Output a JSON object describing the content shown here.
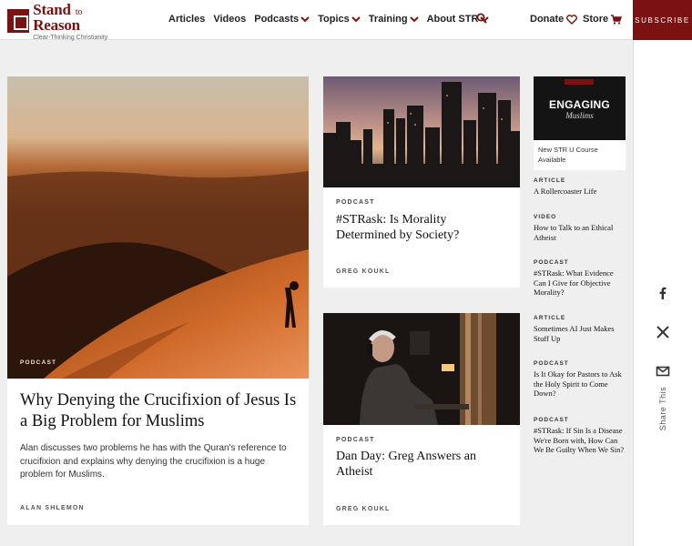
{
  "header": {
    "logo_name_1": "Stand",
    "logo_name_to": "to",
    "logo_name_2": "Reason",
    "logo_tag": "Clear-Thinking Christianity",
    "nav": [
      {
        "label": "Articles"
      },
      {
        "label": "Videos"
      },
      {
        "label": "Podcasts"
      },
      {
        "label": "Topics"
      },
      {
        "label": "Training"
      },
      {
        "label": "About STR"
      }
    ],
    "donate_label": "Donate",
    "store_label": "Store",
    "subscribe_label": "SUBSCRIBE",
    "accent": "#7a1212"
  },
  "feature": {
    "image_label": "PODCAST",
    "title": "Why Denying the Crucifixion of Jesus Is a Big Problem for Muslims",
    "description": "Alan discusses two problems he has with the Quran's reference to crucifixion and explains why denying the crucifixion is a huge problem for Muslims.",
    "author": "ALAN SHLEMON"
  },
  "middle": [
    {
      "kicker": "PODCAST",
      "title": "#STRask: Is Morality Determined by Society?",
      "author": "GREG KOUKL"
    },
    {
      "kicker": "PODCAST",
      "title": "Dan Day: Greg Answers an Atheist",
      "author": "GREG KOUKL"
    }
  ],
  "course": {
    "big": "ENGAGING",
    "small": "Muslims",
    "caption": "New STR U Course Available"
  },
  "sidebar": [
    {
      "kicker": "ARTICLE",
      "title": "A Rollercoaster Life"
    },
    {
      "kicker": "VIDEO",
      "title": "How to Talk to an Ethical Atheist"
    },
    {
      "kicker": "PODCAST",
      "title": "#STRask: What Evidence Can I Give for Objective Morality?"
    },
    {
      "kicker": "ARTICLE",
      "title": "Sometimes AI Just Makes Stuff Up"
    },
    {
      "kicker": "PODCAST",
      "title": "Is It Okay for Pastors to Ask the Holy Spirit to Come Down?"
    },
    {
      "kicker": "PODCAST",
      "title": "#STRask: If Sin Is a Disease We're Born with, How Can We Be Guilty When We Sin?"
    }
  ],
  "share": {
    "label": "Share This",
    "icons": [
      "facebook-icon",
      "x-icon",
      "email-icon"
    ]
  }
}
